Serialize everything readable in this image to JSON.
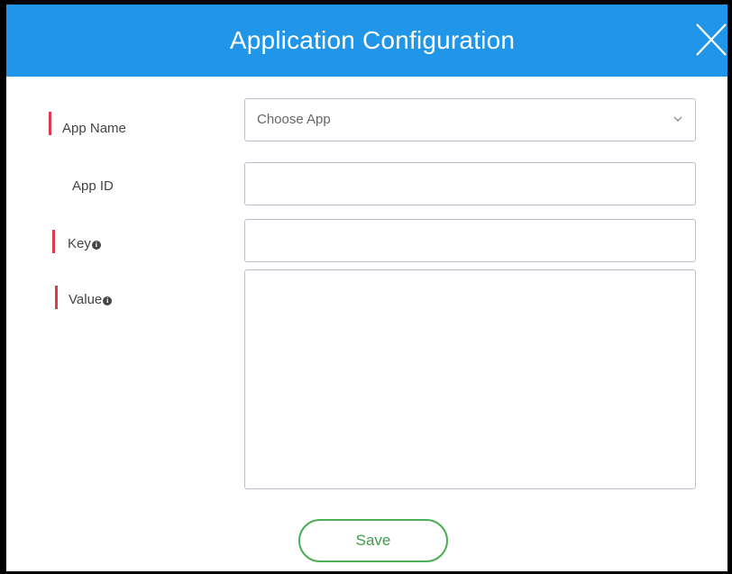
{
  "dialog": {
    "title": "Application Configuration"
  },
  "form": {
    "app_name": {
      "label": "App Name",
      "required": true,
      "selected_value": "Choose App"
    },
    "app_id": {
      "label": "App ID",
      "required": false,
      "value": ""
    },
    "key": {
      "label": "Key",
      "required": true,
      "info_icon": "info-icon",
      "value": ""
    },
    "value": {
      "label": "Value",
      "required": true,
      "info_icon": "info-icon",
      "value": ""
    }
  },
  "actions": {
    "save_label": "Save"
  },
  "colors": {
    "header": "#2196e8",
    "required_marker": "#e03a4e",
    "save_accent": "#4cae57"
  },
  "icons": {
    "close": "close-icon",
    "dropdown": "chevron-down-icon"
  }
}
